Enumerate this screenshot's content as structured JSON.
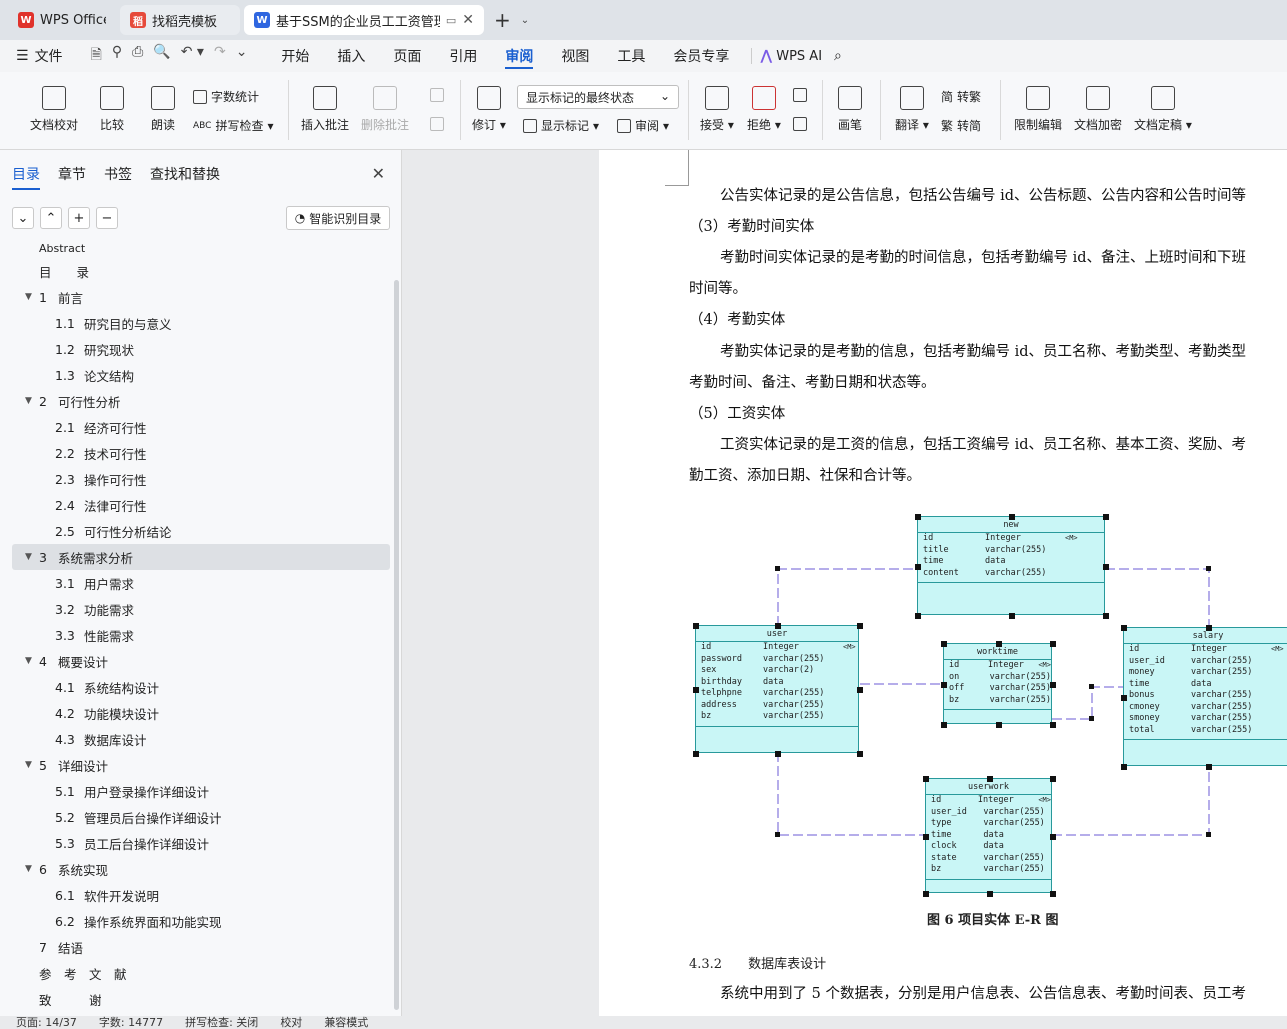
{
  "tabs": [
    {
      "label": "WPS Office",
      "icon": "wps-logo-icon",
      "color": "#e0322b"
    },
    {
      "label": "找稻壳模板",
      "icon": "docer-icon",
      "color": "#e64a3b"
    },
    {
      "label": "基于SSM的企业员工工资管理系",
      "icon": "word-doc-icon",
      "color": "#2f66e0"
    }
  ],
  "menu": {
    "file": "文件",
    "items": [
      "开始",
      "插入",
      "页面",
      "引用",
      "审阅",
      "视图",
      "工具",
      "会员专享"
    ],
    "active": "审阅",
    "wps_ai": "WPS AI"
  },
  "ribbon": {
    "doc_check": "文档校对",
    "compare": "比较",
    "read_aloud": "朗读",
    "word_count": "字数统计",
    "spell_check": "拼写检查",
    "insert_comment": "插入批注",
    "delete_comment": "删除批注",
    "revise": "修订",
    "show_markup_state": "显示标记的最终状态",
    "show_markup": "显示标记",
    "review": "审阅",
    "accept": "接受",
    "reject": "拒绝",
    "pen": "画笔",
    "translate": "翻译",
    "to_traditional": "转繁",
    "to_simplified": "转简",
    "restrict_edit": "限制编辑",
    "encrypt": "文档加密",
    "finalize": "文档定稿"
  },
  "nav": {
    "tabs": [
      "目录",
      "章节",
      "书签",
      "查找和替换"
    ],
    "smart_toc": "智能识别目录",
    "toc": [
      {
        "num": "",
        "text": "Abstract",
        "level": 0
      },
      {
        "num": "",
        "text": "目　　录",
        "level": 0
      },
      {
        "num": "1",
        "text": "前言",
        "level": 1
      },
      {
        "num": "1.1",
        "text": "研究目的与意义",
        "level": 2
      },
      {
        "num": "1.2",
        "text": "研究现状",
        "level": 2
      },
      {
        "num": "1.3",
        "text": "论文结构",
        "level": 2
      },
      {
        "num": "2",
        "text": "可行性分析",
        "level": 1
      },
      {
        "num": "2.1",
        "text": "经济可行性",
        "level": 2
      },
      {
        "num": "2.2",
        "text": "技术可行性",
        "level": 2
      },
      {
        "num": "2.3",
        "text": "操作可行性",
        "level": 2
      },
      {
        "num": "2.4",
        "text": "法律可行性",
        "level": 2
      },
      {
        "num": "2.5",
        "text": "可行性分析结论",
        "level": 2
      },
      {
        "num": "3",
        "text": "系统需求分析",
        "level": 1,
        "selected": true
      },
      {
        "num": "3.1",
        "text": "用户需求",
        "level": 2
      },
      {
        "num": "3.2",
        "text": "功能需求",
        "level": 2
      },
      {
        "num": "3.3",
        "text": "性能需求",
        "level": 2
      },
      {
        "num": "4",
        "text": "概要设计",
        "level": 1
      },
      {
        "num": "4.1",
        "text": "系统结构设计",
        "level": 2
      },
      {
        "num": "4.2",
        "text": "功能模块设计",
        "level": 2
      },
      {
        "num": "4.3",
        "text": "数据库设计",
        "level": 2
      },
      {
        "num": "5",
        "text": "详细设计",
        "level": 1
      },
      {
        "num": "5.1",
        "text": "用户登录操作详细设计",
        "level": 2
      },
      {
        "num": "5.2",
        "text": "管理员后台操作详细设计",
        "level": 2
      },
      {
        "num": "5.3",
        "text": "员工后台操作详细设计",
        "level": 2
      },
      {
        "num": "6",
        "text": "系统实现",
        "level": 1
      },
      {
        "num": "6.1",
        "text": "软件开发说明",
        "level": 2
      },
      {
        "num": "6.2",
        "text": "操作系统界面和功能实现",
        "level": 2
      },
      {
        "num": "7",
        "text": "结语",
        "level": 0
      },
      {
        "num": "",
        "text": "参　考　文　献",
        "level": 0
      },
      {
        "num": "",
        "text": "致　　　谢",
        "level": 0
      }
    ]
  },
  "doc": {
    "lines": [
      "公告实体记录的是公告信息，包括公告编号 id、公告标题、公告内容和公告时间等",
      "（3）考勤时间实体",
      "考勤时间实体记录的是考勤的时间信息，包括考勤编号 id、备注、上班时间和下班",
      "时间等。",
      "（4）考勤实体",
      "考勤实体记录的是考勤的信息，包括考勤编号 id、员工名称、考勤类型、考勤类型",
      "考勤时间、备注、考勤日期和状态等。",
      "（5）工资实体",
      "工资实体记录的是工资的信息，包括工资编号 id、员工名称、基本工资、奖励、考",
      "勤工资、添加日期、社保和合计等。"
    ],
    "caption": "图 6  项目实体 E-R 图",
    "heading": "4.3.2　　数据库表设计",
    "last_line": "系统中用到了 5 个数据表，分别是用户信息表、公告信息表、考勤时间表、员工考"
  },
  "er": {
    "new": {
      "name": "new",
      "rows": [
        [
          "id",
          "Integer",
          "<M>"
        ],
        [
          "title",
          "varchar(255)",
          ""
        ],
        [
          "time",
          "data",
          ""
        ],
        [
          "content",
          "varchar(255)",
          ""
        ]
      ]
    },
    "user": {
      "name": "user",
      "rows": [
        [
          "id",
          "Integer",
          "<M>"
        ],
        [
          "password",
          "varchar(255)",
          ""
        ],
        [
          "sex",
          "varchar(2)",
          ""
        ],
        [
          "birthday",
          "data",
          ""
        ],
        [
          "telphpne",
          "varchar(255)",
          ""
        ],
        [
          "address",
          "varchar(255)",
          ""
        ],
        [
          "bz",
          "varchar(255)",
          ""
        ]
      ]
    },
    "worktime": {
      "name": "worktime",
      "rows": [
        [
          "id",
          "Integer",
          "<M>"
        ],
        [
          "on",
          "varchar(255)",
          ""
        ],
        [
          "off",
          "varchar(255)",
          ""
        ],
        [
          "bz",
          "varchar(255)",
          ""
        ]
      ]
    },
    "salary": {
      "name": "salary",
      "rows": [
        [
          "id",
          "Integer",
          "<M>"
        ],
        [
          "user_id",
          "varchar(255)",
          ""
        ],
        [
          "money",
          "varchar(255)",
          ""
        ],
        [
          "time",
          "data",
          ""
        ],
        [
          "bonus",
          "varchar(255)",
          ""
        ],
        [
          "cmoney",
          "varchar(255)",
          ""
        ],
        [
          "smoney",
          "varchar(255)",
          ""
        ],
        [
          "total",
          "varchar(255)",
          ""
        ]
      ]
    },
    "userwork": {
      "name": "userwork",
      "rows": [
        [
          "id",
          "Integer",
          "<M>"
        ],
        [
          "user_id",
          "varchar(255)",
          ""
        ],
        [
          "type",
          "varchar(255)",
          ""
        ],
        [
          "time",
          "data",
          ""
        ],
        [
          "clock",
          "data",
          ""
        ],
        [
          "state",
          "varchar(255)",
          ""
        ],
        [
          "bz",
          "varchar(255)",
          ""
        ]
      ]
    }
  },
  "status": {
    "page": "页面: 14/37",
    "words": "字数: 14777",
    "spell": "拼写检查: 关闭",
    "proof": "校对",
    "compat": "兼容模式"
  },
  "colors": {
    "accent": "#1a5fd0",
    "er_fill": "#c9f6f6",
    "er_border": "#28999b",
    "er_link": "#6b5bd6"
  }
}
